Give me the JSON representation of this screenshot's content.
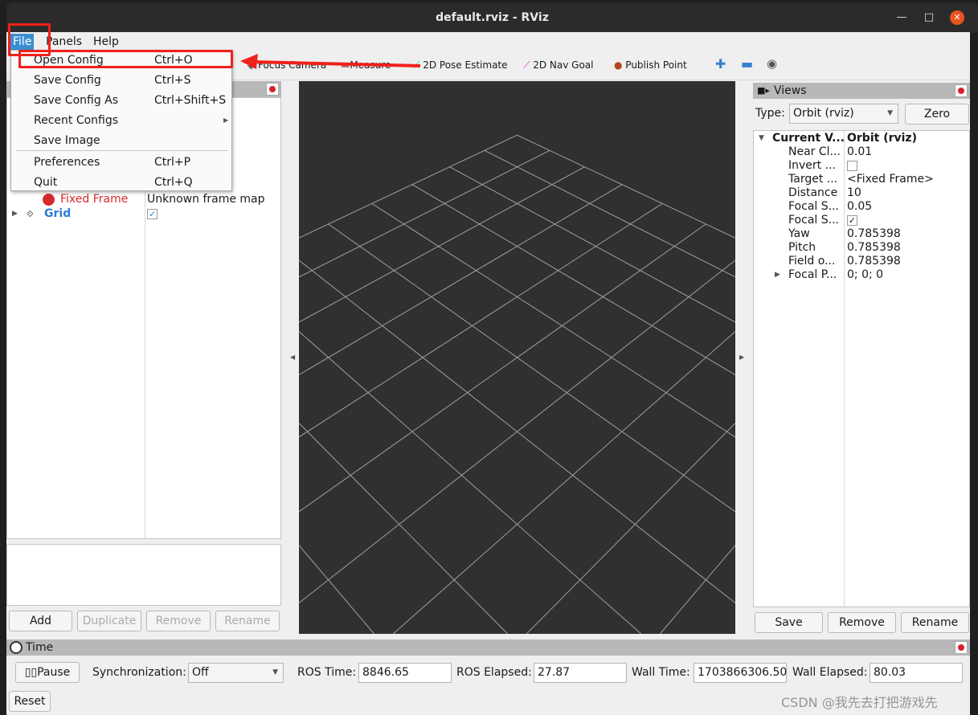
{
  "window": {
    "title": "default.rviz - RViz"
  },
  "menubar": [
    {
      "label": "File"
    },
    {
      "label": "Panels"
    },
    {
      "label": "Help"
    }
  ],
  "file_menu": [
    {
      "label": "Open Config",
      "shortcut": "Ctrl+O"
    },
    {
      "label": "Save Config",
      "shortcut": "Ctrl+S"
    },
    {
      "label": "Save Config As",
      "shortcut": "Ctrl+Shift+S"
    },
    {
      "label": "Recent Configs",
      "shortcut": ""
    },
    {
      "label": "Save Image",
      "shortcut": ""
    },
    {
      "label": "Preferences",
      "shortcut": "Ctrl+P"
    },
    {
      "label": "Quit",
      "shortcut": "Ctrl+Q"
    }
  ],
  "toolbar": {
    "focus_camera": "Focus Camera",
    "measure": "Measure",
    "pose_estimate": "2D Pose Estimate",
    "nav_goal": "2D Nav Goal",
    "publish_point": "Publish Point"
  },
  "displays": {
    "rows": [
      {
        "name": "Fixed Frame",
        "value": "Unknown frame map",
        "status": "error"
      },
      {
        "name": "Grid",
        "value": "checked"
      }
    ],
    "buttons": {
      "add": "Add",
      "duplicate": "Duplicate",
      "remove": "Remove",
      "rename": "Rename"
    }
  },
  "views": {
    "title": "Views",
    "type_label": "Type:",
    "type_value": "Orbit (rviz)",
    "zero": "Zero",
    "rows": [
      {
        "name": "Current V...",
        "value": "Orbit (rviz)"
      },
      {
        "name": "Near Cl...",
        "value": "0.01"
      },
      {
        "name": "Invert ...",
        "value": ""
      },
      {
        "name": "Target ...",
        "value": "<Fixed Frame>"
      },
      {
        "name": "Distance",
        "value": "10"
      },
      {
        "name": "Focal S...",
        "value": "0.05"
      },
      {
        "name": "Focal S...",
        "value": ""
      },
      {
        "name": "Yaw",
        "value": "0.785398"
      },
      {
        "name": "Pitch",
        "value": "0.785398"
      },
      {
        "name": "Field o...",
        "value": "0.785398"
      },
      {
        "name": "Focal P...",
        "value": "0; 0; 0"
      }
    ],
    "buttons": {
      "save": "Save",
      "remove": "Remove",
      "rename": "Rename"
    }
  },
  "time": {
    "title": "Time",
    "pause": "Pause",
    "sync_label": "Synchronization:",
    "sync_value": "Off",
    "ros_time_label": "ROS Time:",
    "ros_time": "8846.65",
    "ros_elapsed_label": "ROS Elapsed:",
    "ros_elapsed": "27.87",
    "wall_time_label": "Wall Time:",
    "wall_time": "1703866306.50",
    "wall_elapsed_label": "Wall Elapsed:",
    "wall_elapsed": "80.03",
    "reset": "Reset"
  },
  "watermark": "CSDN @我先去打把游戏先",
  "colors": {
    "highlight": "#f0201a",
    "menu_active": "#3a8fd0",
    "viewport_bg": "#303030",
    "grid": "#a0a0a0"
  }
}
